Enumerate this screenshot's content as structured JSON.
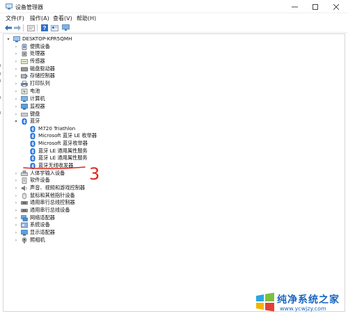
{
  "window": {
    "title": "设备管理器"
  },
  "menu": [
    "文件(F)",
    "操作(A)",
    "查看(V)",
    "帮助(H)"
  ],
  "toolbar_icons": [
    "back-arrow-icon",
    "forward-arrow-icon",
    "properties-icon",
    "help-icon",
    "scan-icon",
    "monitor-icon"
  ],
  "tree": {
    "root": "DESKTOP-KPR5QMH",
    "categories": [
      {
        "label": "便携设备",
        "icon": "portable-device-icon"
      },
      {
        "label": "处理器",
        "icon": "processor-icon"
      },
      {
        "label": "传感器",
        "icon": "sensor-icon"
      },
      {
        "label": "磁盘驱动器",
        "icon": "disk-drive-icon"
      },
      {
        "label": "存储控制器",
        "icon": "storage-controller-icon"
      },
      {
        "label": "打印队列",
        "icon": "printer-icon"
      },
      {
        "label": "电池",
        "icon": "battery-icon"
      },
      {
        "label": "计算机",
        "icon": "computer-icon"
      },
      {
        "label": "监视器",
        "icon": "monitor-icon"
      },
      {
        "label": "键盘",
        "icon": "keyboard-icon"
      },
      {
        "label": "蓝牙",
        "icon": "bluetooth-icon"
      }
    ],
    "bluetooth_children": [
      "M720 Triathlon",
      "Microsoft 蓝牙 LE 枚举器",
      "Microsoft 蓝牙枚举器",
      "蓝牙 LE 通用属性服务",
      "蓝牙 LE 通用属性服务",
      "蓝牙无线收发器"
    ],
    "categories_after": [
      {
        "label": "人体学输入设备",
        "icon": "hid-icon"
      },
      {
        "label": "软件设备",
        "icon": "software-device-icon"
      },
      {
        "label": "声音、视频和游戏控制器",
        "icon": "sound-icon"
      },
      {
        "label": "鼠标和其他指针设备",
        "icon": "mouse-icon"
      },
      {
        "label": "通用串行总线控制器",
        "icon": "usb-icon"
      },
      {
        "label": "通用串行总线设备",
        "icon": "usb-device-icon"
      },
      {
        "label": "网络适配器",
        "icon": "network-icon"
      },
      {
        "label": "系统设备",
        "icon": "system-device-icon"
      },
      {
        "label": "显示适配器",
        "icon": "display-adapter-icon"
      },
      {
        "label": "照相机",
        "icon": "camera-icon"
      }
    ]
  },
  "annotation": {
    "number": "3",
    "color": "#e0261c"
  },
  "watermark": {
    "line1": "纯净系统之家",
    "line2": "www.ycwjzy.com"
  },
  "colors": {
    "accent": "#1a66c2",
    "bluetooth": "#1e6fd9"
  }
}
